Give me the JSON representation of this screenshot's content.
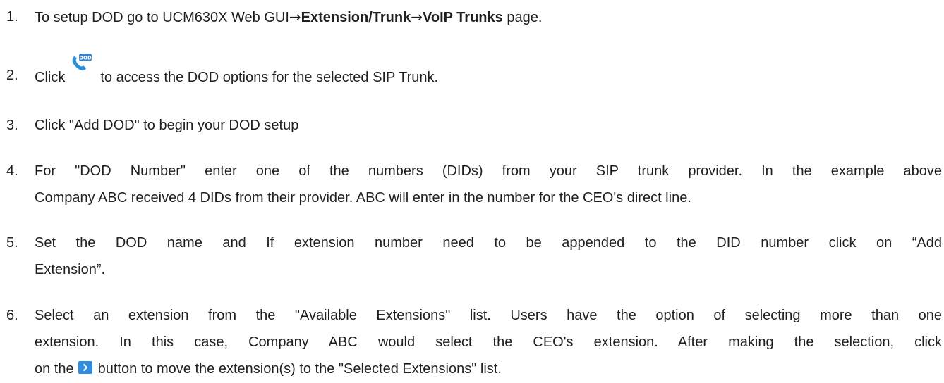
{
  "steps": [
    {
      "number": "1.",
      "prefix": "To setup DOD go to UCM630X Web GUI",
      "arrow1": "→",
      "bold1": "Extension/Trunk",
      "arrow2": "→",
      "bold2": "VoIP Trunks",
      "suffix": " page."
    },
    {
      "number": "2.",
      "before_icon": "Click",
      "icon": "dod-phone-icon",
      "icon_text": "DOD",
      "after_icon": "to access the DOD options for the selected SIP Trunk."
    },
    {
      "number": "3.",
      "text": "Click \"Add DOD\" to begin your DOD setup"
    },
    {
      "number": "4.",
      "line1": "For \"DOD Number\" enter one of the numbers (DIDs) from your SIP trunk provider. In the example above",
      "line2": "Company ABC received 4 DIDs from their provider. ABC will enter in the number for the CEO's direct line."
    },
    {
      "number": "5.",
      "line1": "Set the DOD name and If extension number need to be appended to the DID number click on “Add",
      "line2": "Extension”."
    },
    {
      "number": "6.",
      "line1": "Select an extension from the \"Available Extensions\" list. Users have the option of selecting more than one",
      "line2": "extension. In this case, Company ABC would select the CEO's extension. After making the selection, click",
      "line3_before": "on the",
      "icon": "move-right-icon",
      "line3_after": "button to move the extension(s) to the \"Selected Extensions\" list."
    }
  ],
  "colors": {
    "text": "#1f1f1f",
    "icon_blue": "#2b8fd9",
    "icon_badge": "#3a7fc4",
    "move_button": "#2f8ee0"
  }
}
